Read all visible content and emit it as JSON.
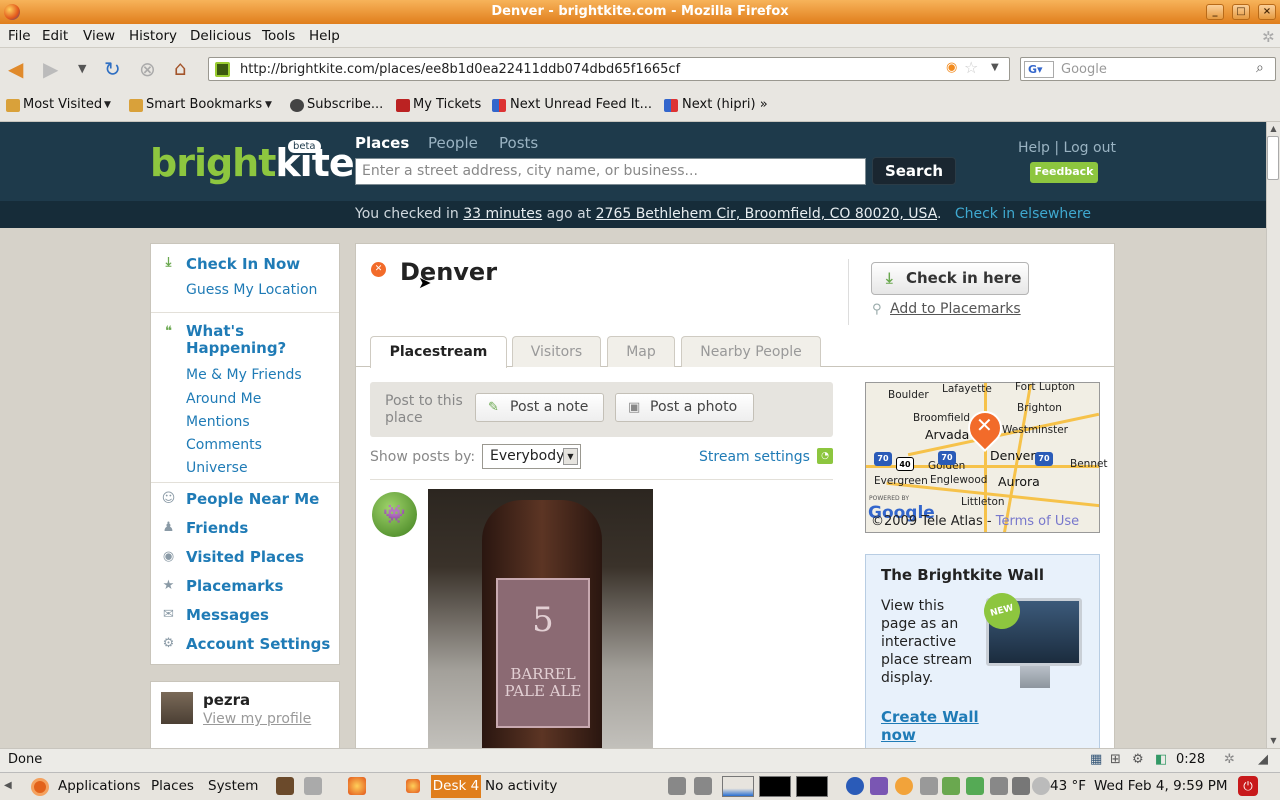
{
  "window": {
    "title": "Denver - brightkite.com - Mozilla Firefox"
  },
  "menubar": [
    "File",
    "Edit",
    "View",
    "History",
    "Delicious",
    "Tools",
    "Help"
  ],
  "url": "http://brightkite.com/places/ee8b1d0ea22411ddb074dbd65f1665cf",
  "search_engine_placeholder": "Google",
  "bookmarks": [
    "Most Visited",
    "Smart Bookmarks",
    "Subscribe...",
    "My Tickets",
    "Next Unread Feed It...",
    "Next (hipri) »"
  ],
  "brightkite": {
    "logo_a": "bright",
    "logo_b": "kite",
    "beta": "beta",
    "tabs": [
      "Places",
      "People",
      "Posts"
    ],
    "search_placeholder": "Enter a street address, city name, or business...",
    "search_button": "Search",
    "help": "Help",
    "logout": "Log out",
    "feedback": "Feedback",
    "checkin_prefix": "You checked in ",
    "checkin_time": "33 minutes",
    "checkin_mid": " ago at ",
    "checkin_address": "2765 Bethlehem Cir, Broomfield, CO 80020, USA",
    "checkin_end": ".",
    "checkin_elsewhere": "Check in elsewhere"
  },
  "sidebar": {
    "checkin_now": "Check In Now",
    "guess_location": "Guess My Location",
    "whats_happening": "What's Happening?",
    "whats_sub": [
      "Me & My Friends",
      "Around Me",
      "Mentions",
      "Comments",
      "Universe"
    ],
    "people_near_me": "People Near Me",
    "friends": "Friends",
    "visited_places": "Visited Places",
    "placemarks": "Placemarks",
    "messages": "Messages",
    "account_settings": "Account Settings",
    "profile_name": "pezra",
    "profile_link": "View my profile"
  },
  "place": {
    "title": "Denver",
    "checkin_here": "Check in here",
    "add_placemarks": "Add to Placemarks",
    "tabs": [
      "Placestream",
      "Visitors",
      "Map",
      "Nearby People"
    ],
    "post_to_place": "Post to this place",
    "post_note": "Post a note",
    "post_photo": "Post a photo",
    "show_posts_label": "Show posts by:",
    "show_posts_value": "Everybody",
    "stream_settings": "Stream settings",
    "photo_label_number": "5",
    "photo_label_text": "BARREL\nPALE ALE"
  },
  "map": {
    "cities": [
      "Boulder",
      "Lafayette",
      "Fort Lupton",
      "Brighton",
      "Broomfield",
      "Westminster",
      "Arvada",
      "Denver",
      "Golden",
      "Englewood",
      "Aurora",
      "Littleton",
      "Evergreen",
      "Bennet"
    ],
    "shields": [
      "70",
      "40",
      "70",
      "70"
    ],
    "powered_by": "POWERED BY",
    "google": "Google",
    "copyright": "©2009 Tele Atlas - ",
    "terms": "Terms of Use"
  },
  "wall": {
    "title": "The Brightkite Wall",
    "text": "View this page as an interactive place stream display.",
    "badge": "NEW",
    "cta": "Create Wall now"
  },
  "statusbar": {
    "text": "Done",
    "time": "0:28"
  },
  "panel": {
    "applications": "Applications",
    "places": "Places",
    "system": "System",
    "desk": "Desk 4",
    "activity": "No activity",
    "temp": "43 °F",
    "clock": "Wed Feb  4,  9:59 PM"
  },
  "colors": {
    "brand_green": "#8dc63f",
    "header_bg": "#1e3a4b",
    "link_blue": "#1f7bb6",
    "ff_title": "#e07e1c"
  }
}
